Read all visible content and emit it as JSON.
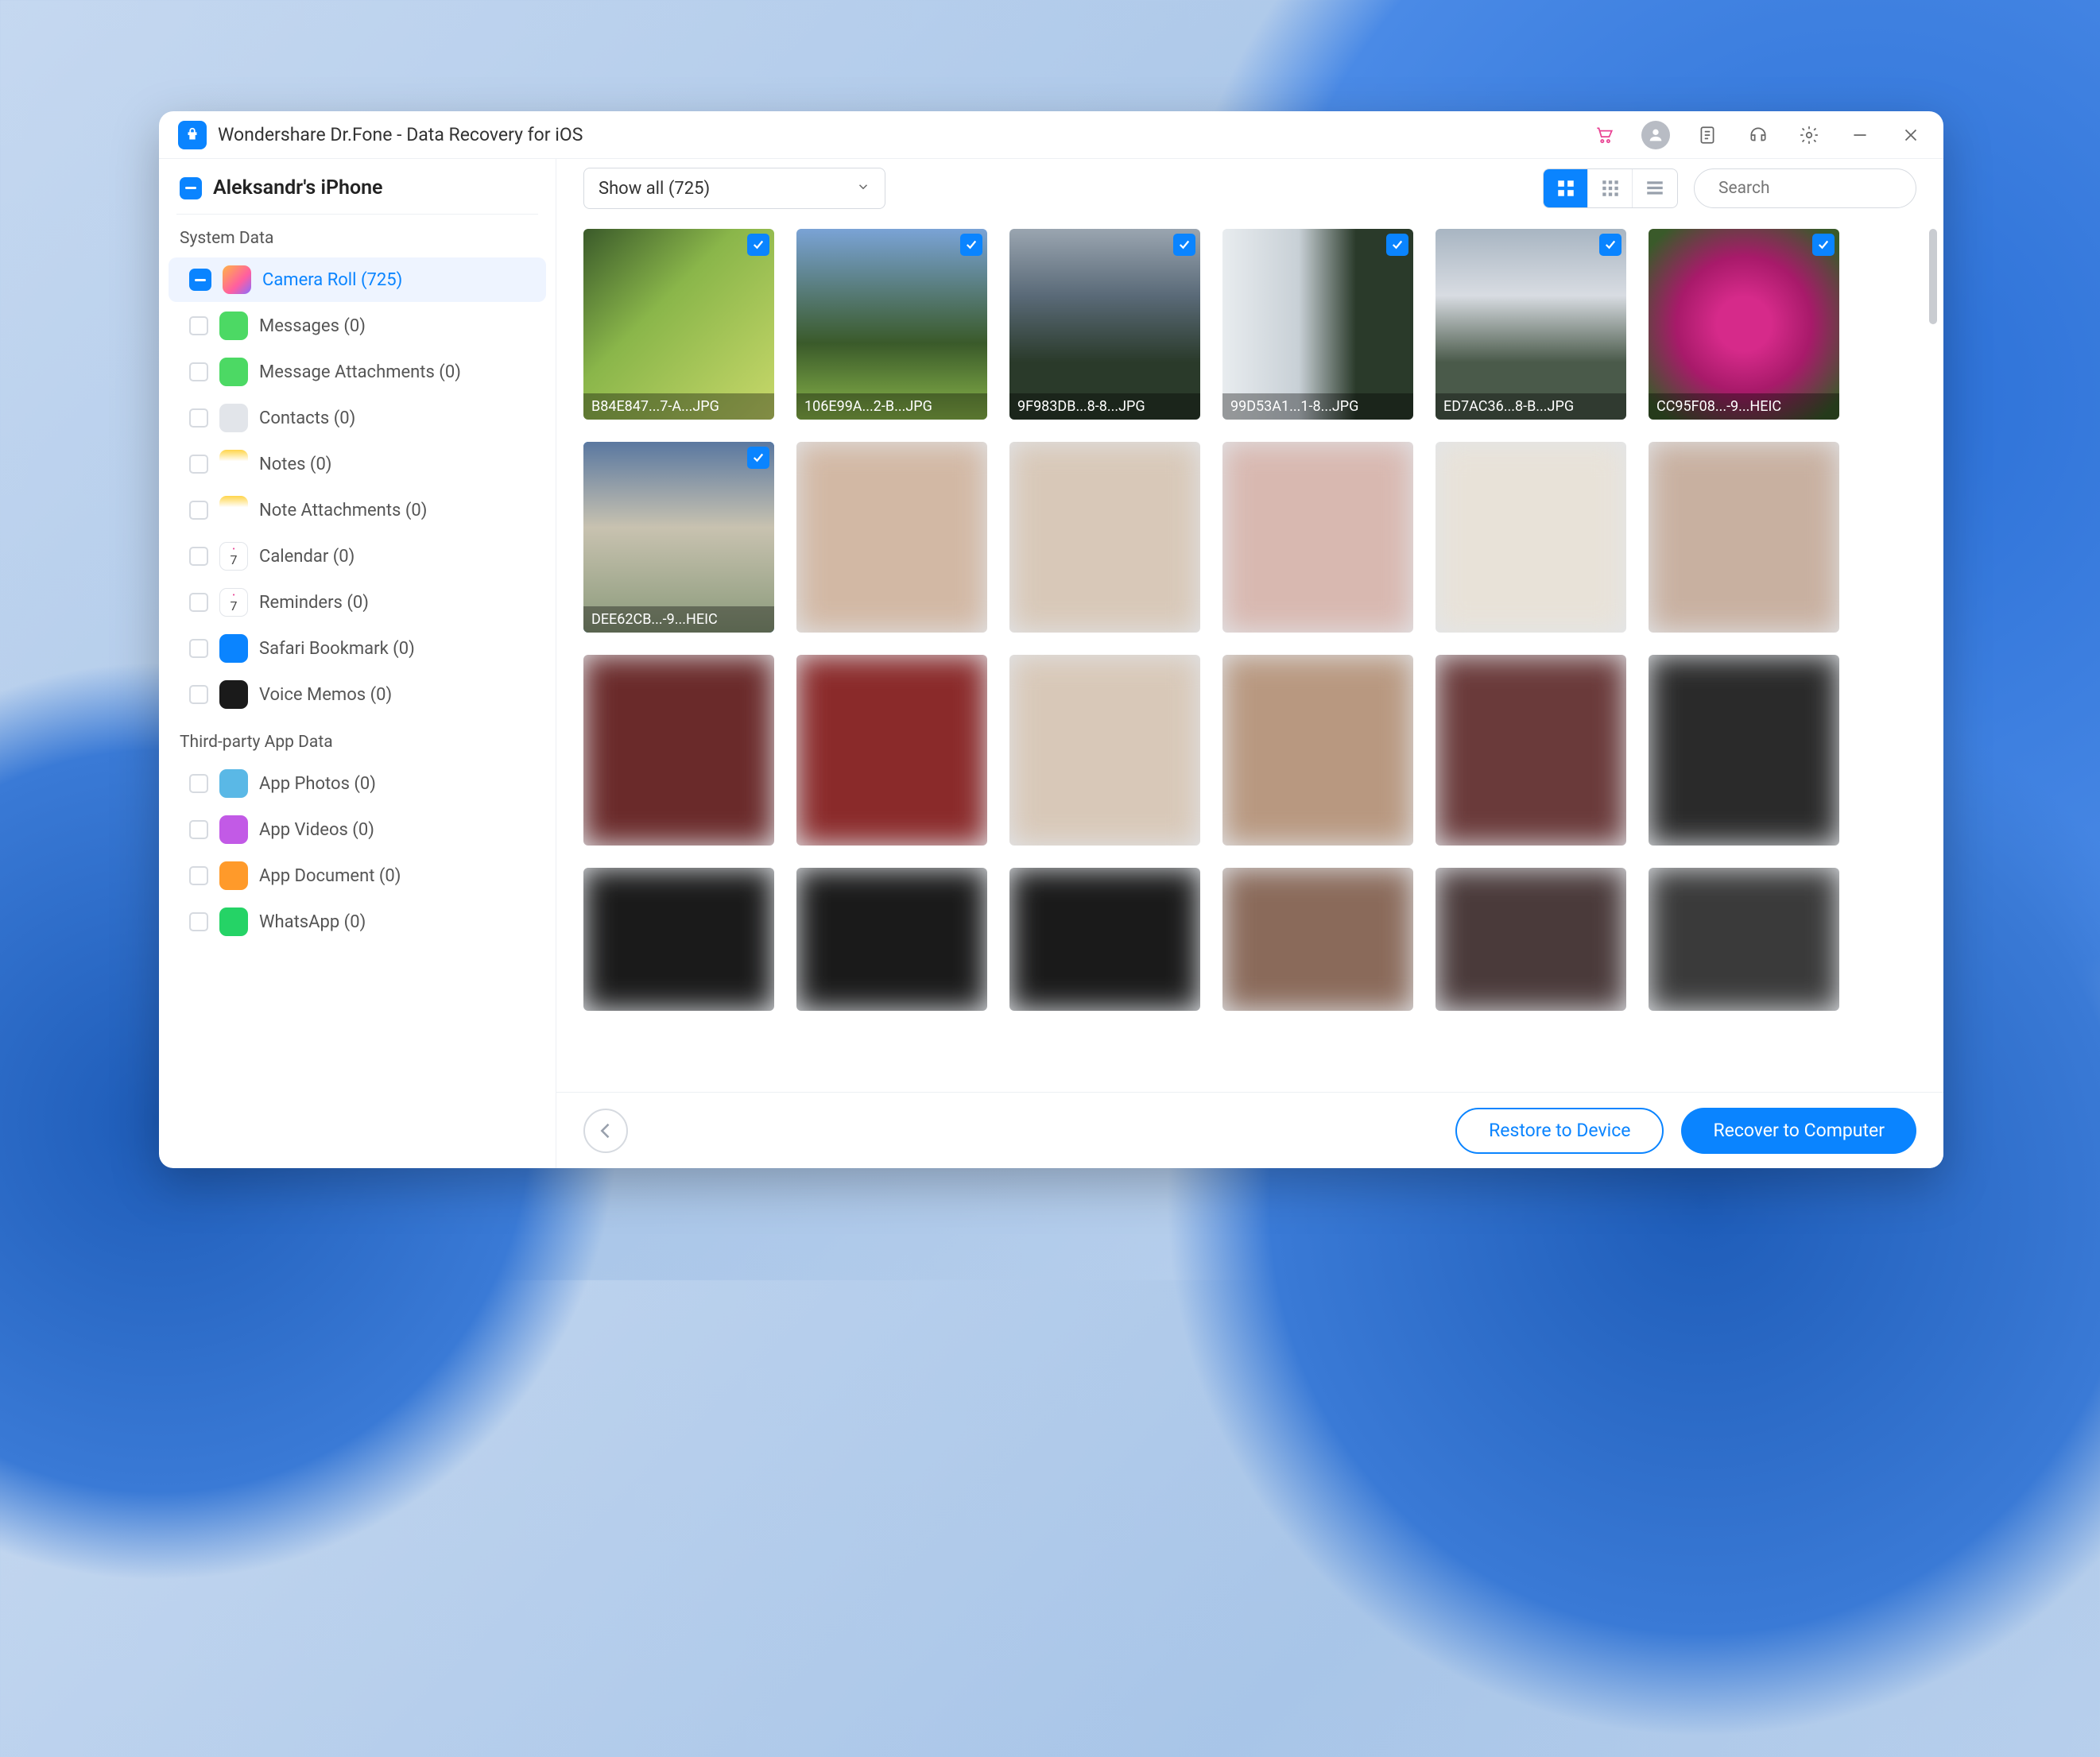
{
  "app": {
    "title": "Wondershare Dr.Fone - Data Recovery for iOS"
  },
  "device": {
    "name": "Aleksandr's iPhone"
  },
  "sections": {
    "system": "System Data",
    "third": "Third-party App Data"
  },
  "sidebar": {
    "items": [
      {
        "label": "Camera Roll (725)",
        "iconClass": "ic-photos",
        "active": true,
        "hasToggle": true
      },
      {
        "label": "Messages (0)",
        "iconClass": "ic-msg"
      },
      {
        "label": "Message Attachments (0)",
        "iconClass": "ic-msg"
      },
      {
        "label": "Contacts (0)",
        "iconClass": "ic-contacts"
      },
      {
        "label": "Notes (0)",
        "iconClass": "ic-notes"
      },
      {
        "label": "Note Attachments (0)",
        "iconClass": "ic-notes"
      },
      {
        "label": "Calendar (0)",
        "iconClass": "ic-cal"
      },
      {
        "label": "Reminders (0)",
        "iconClass": "ic-cal"
      },
      {
        "label": "Safari Bookmark (0)",
        "iconClass": "ic-safari"
      },
      {
        "label": "Voice Memos (0)",
        "iconClass": "ic-voice"
      }
    ],
    "third": [
      {
        "label": "App Photos (0)",
        "iconClass": "ic-appphotos"
      },
      {
        "label": "App Videos (0)",
        "iconClass": "ic-appvideos"
      },
      {
        "label": "App Document (0)",
        "iconClass": "ic-appdoc"
      },
      {
        "label": "WhatsApp (0)",
        "iconClass": "ic-wa"
      }
    ]
  },
  "filter": {
    "label": "Show all (725)"
  },
  "search": {
    "placeholder": "Search"
  },
  "thumbs": {
    "row1": [
      {
        "fname": "B84E847...7-A...JPG",
        "cls": "t0",
        "checked": true
      },
      {
        "fname": "106E99A...2-B...JPG",
        "cls": "t1",
        "checked": true
      },
      {
        "fname": "9F983DB...8-8...JPG",
        "cls": "t2",
        "checked": true
      },
      {
        "fname": "99D53A1...1-8...JPG",
        "cls": "t3",
        "checked": true
      },
      {
        "fname": "ED7AC36...8-B...JPG",
        "cls": "t4",
        "checked": true
      },
      {
        "fname": "CC95F08...-9...HEIC",
        "cls": "t5",
        "checked": true
      }
    ],
    "row2": [
      {
        "fname": "DEE62CB...-9...HEIC",
        "cls": "t6",
        "checked": true,
        "selected": true
      },
      {
        "cls": "b0",
        "blur": true
      },
      {
        "cls": "b1",
        "blur": true
      },
      {
        "cls": "b2",
        "blur": true
      },
      {
        "cls": "b3",
        "blur": true
      },
      {
        "cls": "b4",
        "blur": true
      }
    ],
    "row3": [
      {
        "cls": "r0",
        "blur": true
      },
      {
        "cls": "r1",
        "blur": true
      },
      {
        "cls": "r2",
        "blur": true
      },
      {
        "cls": "r3",
        "blur": true
      },
      {
        "cls": "r4",
        "blur": true
      },
      {
        "cls": "r5",
        "blur": true
      }
    ],
    "row4": [
      {
        "cls": "d0",
        "blur": true
      },
      {
        "cls": "d1",
        "blur": true
      },
      {
        "cls": "d2",
        "blur": true
      },
      {
        "cls": "d3",
        "blur": true
      },
      {
        "cls": "d4",
        "blur": true
      },
      {
        "cls": "d5",
        "blur": true
      }
    ]
  },
  "footer": {
    "restore": "Restore to Device",
    "recover": "Recover to Computer"
  }
}
